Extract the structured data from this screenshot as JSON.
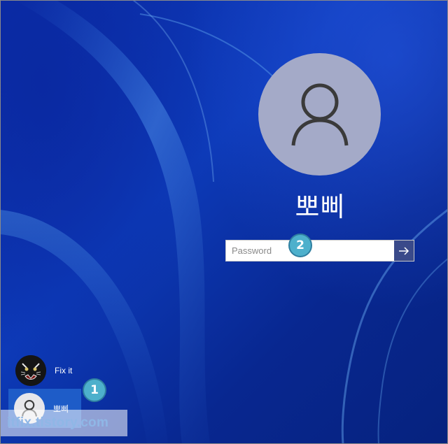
{
  "login": {
    "user_name": "뽀삐",
    "password_placeholder": "Password"
  },
  "badges": {
    "first": "1",
    "second": "2"
  },
  "user_list": [
    {
      "name": "Fix it"
    },
    {
      "name": "뽀삐"
    }
  ],
  "watermark": "itfix.tistory.com",
  "colors": {
    "background": "#0a2a9a",
    "avatar_bg": "#a4aac8",
    "badge": "#4db0cc",
    "selected_user": "#1e5cc8",
    "submit_button": "#3a4a8a"
  },
  "icons": {
    "large_avatar": "user-silhouette-icon",
    "submit": "arrow-right-icon",
    "fixit_avatar": "tiger-icon",
    "bbo_avatar": "user-silhouette-icon"
  }
}
